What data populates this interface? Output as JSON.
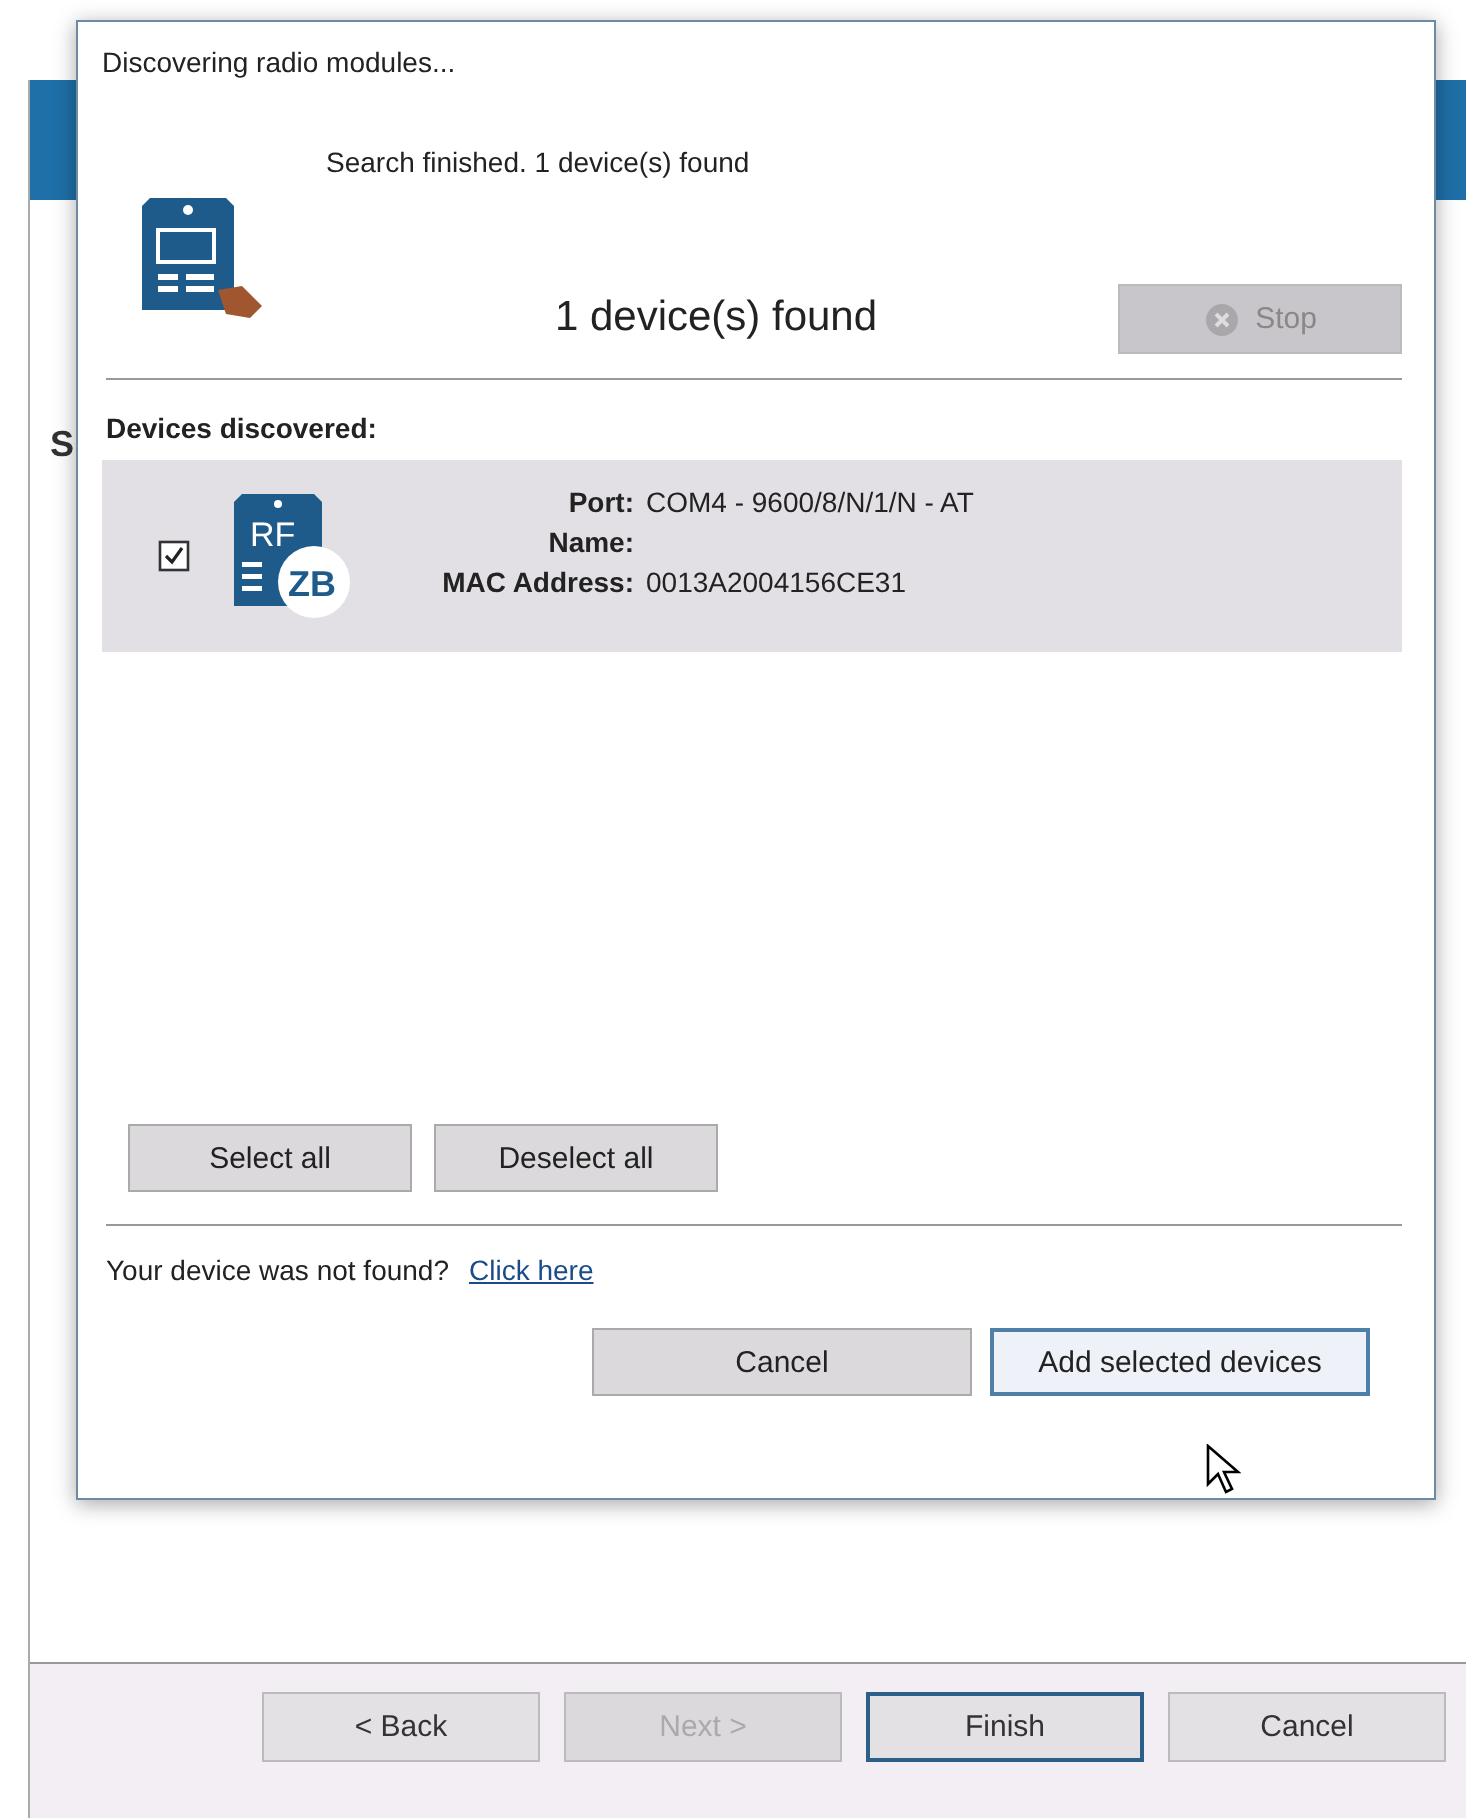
{
  "background_window": {
    "label": "S",
    "buttons": [
      {
        "label": "< Back",
        "disabled": false,
        "focused": false
      },
      {
        "label": "Next >",
        "disabled": true,
        "focused": false
      },
      {
        "label": "Finish",
        "disabled": false,
        "focused": true
      },
      {
        "label": "Cancel",
        "disabled": false,
        "focused": false
      }
    ]
  },
  "dialog": {
    "title": "Discovering radio modules...",
    "status": "Search finished. 1 device(s) found",
    "found_count": "1 device(s) found",
    "stop_button": {
      "label": "Stop",
      "disabled": true
    },
    "section_label": "Devices discovered:",
    "devices": [
      {
        "checked": true,
        "selected": true,
        "module_label": "RF",
        "badge": "ZB",
        "fields": [
          {
            "label": "Port:",
            "value": "COM4 - 9600/8/N/1/N - AT"
          },
          {
            "label": "Name:"
          },
          {
            "label": "MAC Address:",
            "value": "0013A2004156CE31"
          }
        ]
      }
    ],
    "select_buttons": [
      "Select all",
      "Deselect all"
    ],
    "not_found": {
      "text": "Your device was not found?",
      "link": "Click here"
    },
    "buttons": [
      {
        "label": "Cancel",
        "focused": false
      },
      {
        "label": "Add selected devices",
        "focused": true
      }
    ]
  }
}
